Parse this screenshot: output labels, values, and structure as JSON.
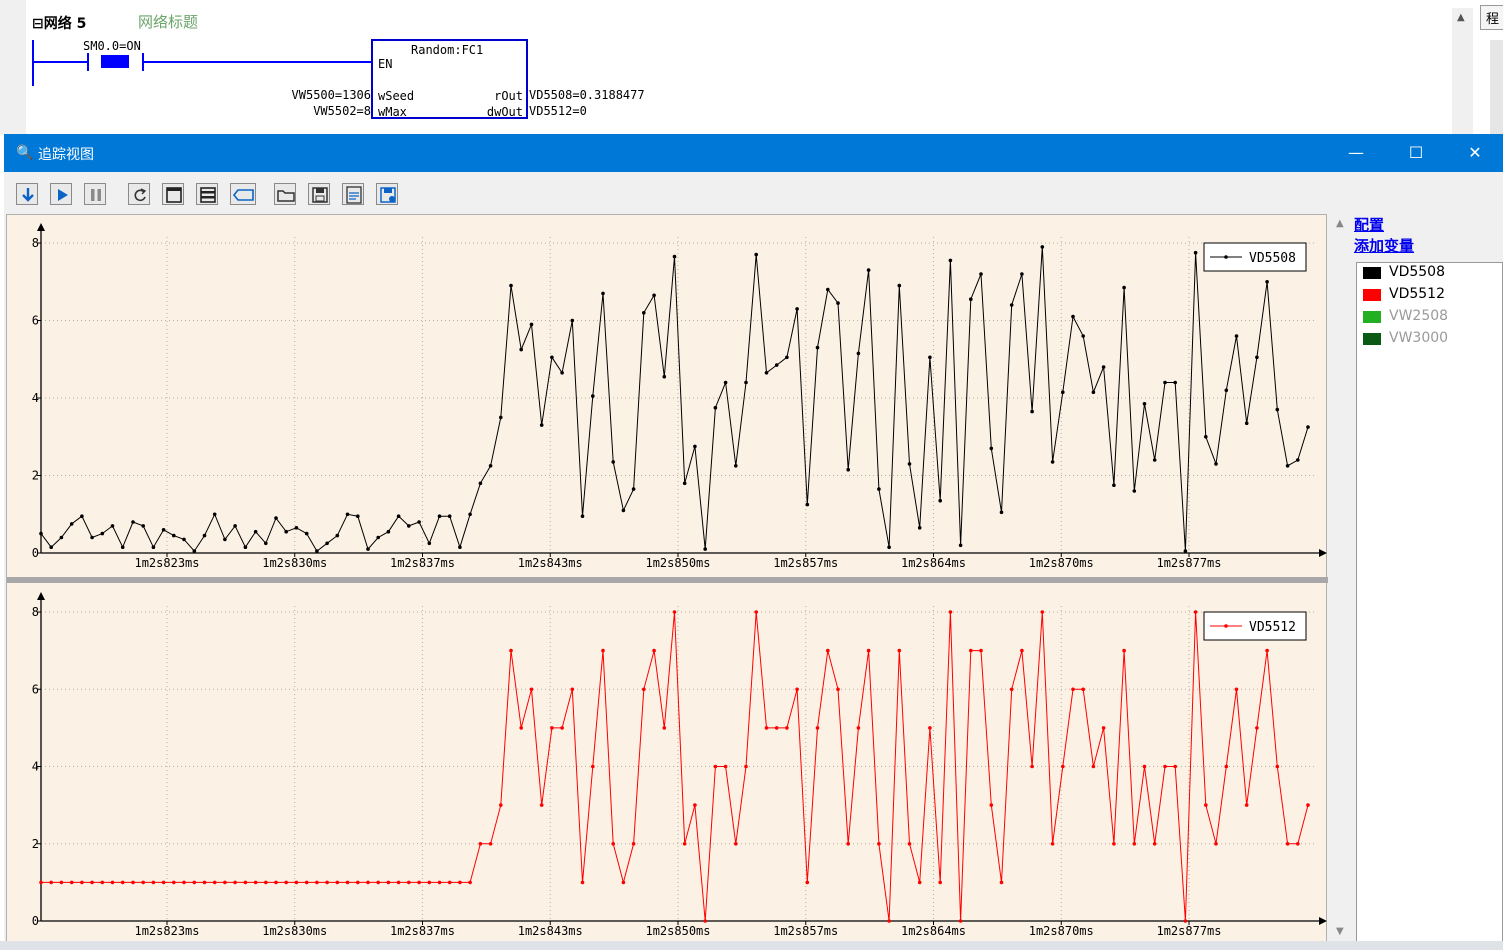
{
  "ladder": {
    "network_label": "网络 5",
    "network_comment": "网络标题",
    "contact_label": "SM0.0=ON",
    "block_title": "Random:FC1",
    "block_en": "EN",
    "in1_name": "wSeed",
    "in2_name": "wMax",
    "out1_name": "rOut",
    "out2_name": "dwOut",
    "in1_value": "VW5500=1306",
    "in2_value": "VW5502=8",
    "out1_value": "VD5508=0.3188477",
    "out2_value": "VD5512=0",
    "side_tab": "程"
  },
  "window": {
    "title": "追踪视图",
    "minimize": "—",
    "maximize": "☐",
    "close": "✕"
  },
  "toolbar": {
    "buttons": [
      "download-icon",
      "play-icon",
      "pause-icon",
      "refresh-icon",
      "window-icon",
      "split-icon",
      "tag-icon",
      "open-folder-icon",
      "save-icon",
      "csv-icon",
      "save-as-icon"
    ],
    "accent": "#0a64c8"
  },
  "panel": {
    "config_link": "配置",
    "add_var_link": "添加变量",
    "variables": [
      {
        "name": "VD5508",
        "color": "#000000",
        "active": true
      },
      {
        "name": "VD5512",
        "color": "#ff0000",
        "active": true
      },
      {
        "name": "VW2508",
        "color": "#22b022",
        "active": false
      },
      {
        "name": "VW3000",
        "color": "#0a5a14",
        "active": false
      }
    ]
  },
  "chart_data": [
    {
      "type": "line",
      "series": [
        {
          "name": "VD5508",
          "color": "#000000",
          "values": [
            0.5,
            0.15,
            0.4,
            0.75,
            0.95,
            0.4,
            0.5,
            0.7,
            0.15,
            0.8,
            0.7,
            0.15,
            0.6,
            0.45,
            0.35,
            0.05,
            0.45,
            1.0,
            0.35,
            0.7,
            0.15,
            0.55,
            0.25,
            0.9,
            0.55,
            0.65,
            0.5,
            0.05,
            0.25,
            0.45,
            1.0,
            0.95,
            0.1,
            0.4,
            0.55,
            0.95,
            0.7,
            0.8,
            0.25,
            0.95,
            0.95,
            0.15,
            1.0,
            1.8,
            2.25,
            3.5,
            6.9,
            5.25,
            5.9,
            3.3,
            5.05,
            4.65,
            6.0,
            0.95,
            4.05,
            6.7,
            2.35,
            1.1,
            1.65,
            6.2,
            6.65,
            4.55,
            7.65,
            1.8,
            2.75,
            0.1,
            3.75,
            4.4,
            2.25,
            4.4,
            7.7,
            4.65,
            4.85,
            5.05,
            6.3,
            1.25,
            5.3,
            6.8,
            6.45,
            2.15,
            5.15,
            7.3,
            1.65,
            0.15,
            6.9,
            2.3,
            0.65,
            5.05,
            1.35,
            7.55,
            0.2,
            6.55,
            7.2,
            2.7,
            1.05,
            6.4,
            7.2,
            3.65,
            7.9,
            2.35,
            4.15,
            6.1,
            5.6,
            4.15,
            4.8,
            1.75,
            6.85,
            1.6,
            3.85,
            2.4,
            4.4,
            4.4,
            0.05,
            7.75,
            3.0,
            2.3,
            4.2,
            5.6,
            3.35,
            5.05,
            7.0,
            3.7,
            2.25,
            2.4,
            3.25
          ]
        }
      ],
      "x_tick_labels": [
        "1m2s823ms",
        "1m2s830ms",
        "1m2s837ms",
        "1m2s843ms",
        "1m2s850ms",
        "1m2s857ms",
        "1m2s864ms",
        "1m2s870ms",
        "1m2s877ms"
      ],
      "y_ticks": [
        0,
        2,
        4,
        6,
        8
      ],
      "ylim": [
        0,
        8
      ],
      "legend": "top-right",
      "grid": true
    },
    {
      "type": "line",
      "series": [
        {
          "name": "VD5512",
          "color": "#ff0000",
          "values": [
            1,
            1,
            1,
            1,
            1,
            1,
            1,
            1,
            1,
            1,
            1,
            1,
            1,
            1,
            1,
            1,
            1,
            1,
            1,
            1,
            1,
            1,
            1,
            1,
            1,
            1,
            1,
            1,
            1,
            1,
            1,
            1,
            1,
            1,
            1,
            1,
            1,
            1,
            1,
            1,
            1,
            1,
            1,
            2,
            2,
            3,
            7,
            5,
            6,
            3,
            5,
            5,
            6,
            1,
            4,
            7,
            2,
            1,
            2,
            6,
            7,
            5,
            8,
            2,
            3,
            0,
            4,
            4,
            2,
            4,
            8,
            5,
            5,
            5,
            6,
            1,
            5,
            7,
            6,
            2,
            5,
            7,
            2,
            0,
            7,
            2,
            1,
            5,
            1,
            8,
            0,
            7,
            7,
            3,
            1,
            6,
            7,
            4,
            8,
            2,
            4,
            6,
            6,
            4,
            5,
            2,
            7,
            2,
            4,
            2,
            4,
            4,
            0,
            8,
            3,
            2,
            4,
            6,
            3,
            5,
            7,
            4,
            2,
            2,
            3
          ]
        }
      ],
      "x_tick_labels": [
        "1m2s823ms",
        "1m2s830ms",
        "1m2s837ms",
        "1m2s843ms",
        "1m2s850ms",
        "1m2s857ms",
        "1m2s864ms",
        "1m2s870ms",
        "1m2s877ms"
      ],
      "y_ticks": [
        0,
        2,
        4,
        6,
        8
      ],
      "ylim": [
        0,
        8
      ],
      "legend": "top-right",
      "grid": true
    }
  ]
}
